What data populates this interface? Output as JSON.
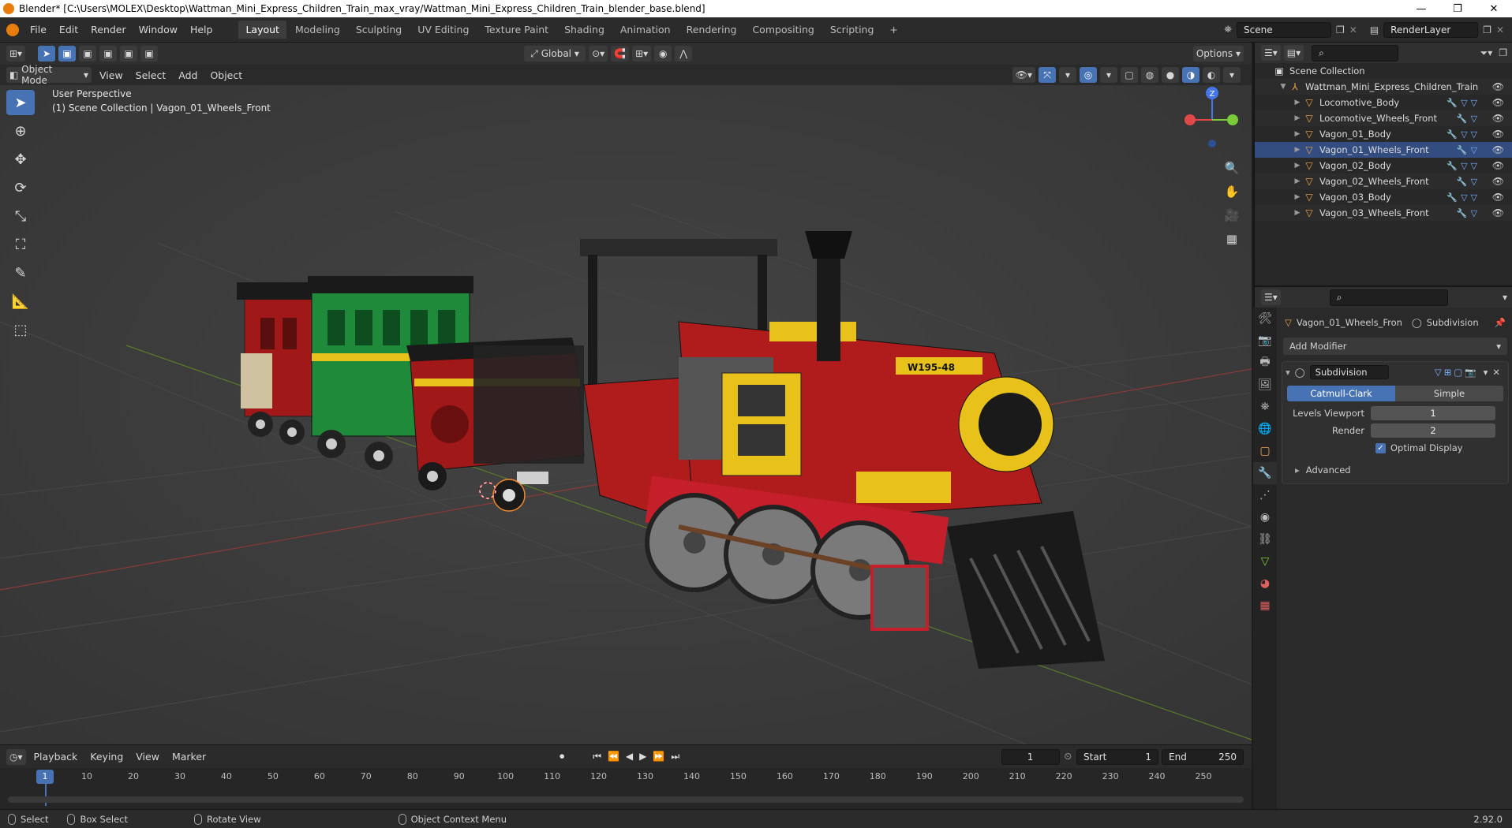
{
  "titlebar": {
    "title": "Blender* [C:\\Users\\MOLEX\\Desktop\\Wattman_Mini_Express_Children_Train_max_vray/Wattman_Mini_Express_Children_Train_blender_base.blend]",
    "minimize": "—",
    "maximize": "❐",
    "close": "✕"
  },
  "menus": [
    "File",
    "Edit",
    "Render",
    "Window",
    "Help"
  ],
  "workspaces": [
    "Layout",
    "Modeling",
    "Sculpting",
    "UV Editing",
    "Texture Paint",
    "Shading",
    "Animation",
    "Rendering",
    "Compositing",
    "Scripting"
  ],
  "active_workspace": "Layout",
  "scene": {
    "label": "Scene",
    "renderlayer": "RenderLayer"
  },
  "viewport_header": {
    "mode": "Object Mode",
    "menus": [
      "View",
      "Select",
      "Add",
      "Object"
    ],
    "transform": "Global",
    "options": "Options"
  },
  "viewport": {
    "perspective": "User Perspective",
    "collection_info": "(1) Scene Collection | Vagon_01_Wheels_Front",
    "gizmo": {
      "x": "X",
      "y": "Y",
      "z": "Z"
    }
  },
  "outliner": {
    "root": "Scene Collection",
    "collection": "Wattman_Mini_Express_Children_Train",
    "items": [
      "Locomotive_Body",
      "Locomotive_Wheels_Front",
      "Vagon_01_Body",
      "Vagon_01_Wheels_Front",
      "Vagon_02_Body",
      "Vagon_02_Wheels_Front",
      "Vagon_03_Body",
      "Vagon_03_Wheels_Front"
    ],
    "selected": "Vagon_01_Wheels_Front"
  },
  "properties": {
    "object_name": "Vagon_01_Wheels_Fron",
    "modifier_tab": "Subdivision",
    "add_modifier": "Add Modifier",
    "modifier_name": "Subdivision",
    "mode_a": "Catmull-Clark",
    "mode_b": "Simple",
    "levels_label": "Levels Viewport",
    "levels_value": "1",
    "render_label": "Render",
    "render_value": "2",
    "optimal_display": "Optimal Display",
    "advanced": "Advanced"
  },
  "timeline": {
    "menus": [
      "Playback",
      "Keying",
      "View",
      "Marker"
    ],
    "current_frame": "1",
    "start_label": "Start",
    "start": "1",
    "end_label": "End",
    "end": "250",
    "ticks": [
      "1",
      "10",
      "20",
      "30",
      "40",
      "50",
      "60",
      "70",
      "80",
      "90",
      "100",
      "110",
      "120",
      "130",
      "140",
      "150",
      "160",
      "170",
      "180",
      "190",
      "200",
      "210",
      "220",
      "230",
      "240",
      "250"
    ]
  },
  "statusbar": {
    "select": "Select",
    "box_select": "Box Select",
    "rotate": "Rotate View",
    "context": "Object Context Menu",
    "version": "2.92.0"
  },
  "colors": {
    "accent": "#4772b3",
    "loco_red": "#b01c1c",
    "yellow": "#e8c21a",
    "green": "#1f8a3a"
  }
}
